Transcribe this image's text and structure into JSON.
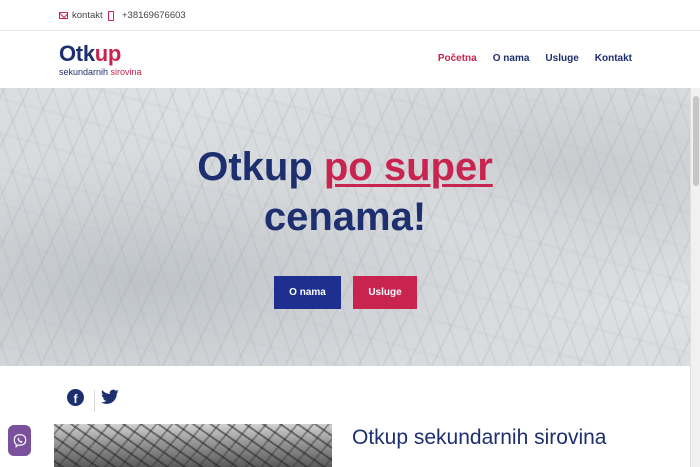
{
  "topbar": {
    "email_label": "kontakt",
    "phone_label": "+38169676603"
  },
  "logo": {
    "main_part": "Otk",
    "main_accent": "up",
    "sub_part": "sekundarnih ",
    "sub_accent": "sirovina"
  },
  "nav": {
    "items": [
      {
        "label": "Početna",
        "active": true
      },
      {
        "label": "O nama",
        "active": false
      },
      {
        "label": "Usluge",
        "active": false
      },
      {
        "label": "Kontakt",
        "active": false
      }
    ]
  },
  "hero": {
    "title_part1": "Otkup ",
    "title_accent": "po super",
    "title_part2": "cenama!",
    "button_primary": "O nama",
    "button_secondary": "Usluge"
  },
  "social": {
    "icons": [
      "facebook-icon",
      "twitter-icon"
    ]
  },
  "section": {
    "title": "Otkup sekundarnih sirovina"
  },
  "colors": {
    "brand_navy": "#1d2f6f",
    "brand_red": "#c9244f",
    "button_blue": "#1d2f8f",
    "viber_purple": "#7b519d"
  }
}
